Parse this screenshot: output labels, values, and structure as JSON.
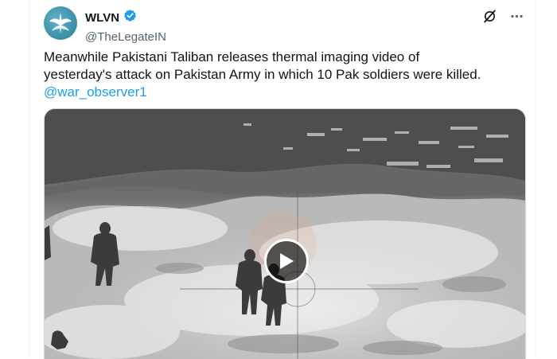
{
  "account": {
    "display_name": "WLVN",
    "handle": "@TheLegateIN",
    "verified_icon": "verified-badge-icon",
    "avatar_icon": "wlvn-logo-icon"
  },
  "actions": {
    "grok_icon": "grok-icon",
    "more_icon": "more-options-icon"
  },
  "tweet": {
    "text_line1": "Meanwhile Pakistani Taliban releases thermal imaging video of",
    "text_line2": "yesterday's attack on Pakistan Army in which 10 Pak soldiers were killed.",
    "mention": "@war_observer1"
  },
  "media": {
    "type": "video",
    "play_icon": "play-icon"
  },
  "colors": {
    "link": "#1d9bf0",
    "verified": "#1d9bf0",
    "text": "#0f1419",
    "secondary": "#536471"
  }
}
